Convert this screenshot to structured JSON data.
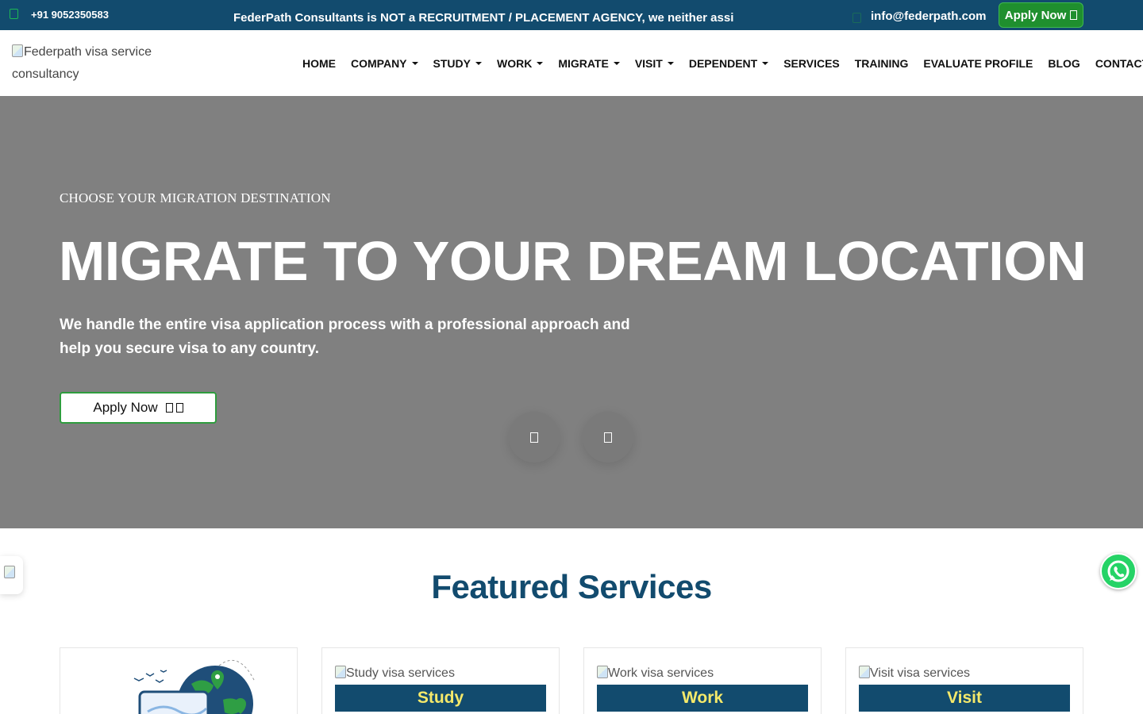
{
  "topbar": {
    "phone": "+91 9052350583",
    "notice": "FederPath Consultants is NOT a RECRUITMENT / PLACEMENT AGENCY, we neither assi",
    "email": "info@federpath.com",
    "apply_label": "Apply Now",
    "colors": {
      "background": "#124b6e",
      "apply": "#1f8f2e"
    }
  },
  "navbar": {
    "logo_alt": "Federpath visa service consultancy",
    "menu": [
      {
        "label": "HOME",
        "dropdown": false
      },
      {
        "label": "COMPANY",
        "dropdown": true
      },
      {
        "label": "STUDY",
        "dropdown": true
      },
      {
        "label": "WORK",
        "dropdown": true
      },
      {
        "label": "MIGRATE",
        "dropdown": true
      },
      {
        "label": "VISIT",
        "dropdown": true
      },
      {
        "label": "DEPENDENT",
        "dropdown": true
      },
      {
        "label": "SERVICES",
        "dropdown": false
      },
      {
        "label": "TRAINING",
        "dropdown": false
      },
      {
        "label": "EVALUATE PROFILE",
        "dropdown": false
      },
      {
        "label": "BLOG",
        "dropdown": false
      },
      {
        "label": "CONTACT US",
        "dropdown": false
      }
    ]
  },
  "hero": {
    "eyebrow": "CHOOSE YOUR MIGRATION DESTINATION",
    "title": "MIGRATE TO YOUR DREAM LOCATION",
    "subtitle": "We handle the entire visa application process with a professional approach and help you secure visa to any country.",
    "apply_label": "Apply Now"
  },
  "featured": {
    "title": "Featured Services",
    "cards": [
      {
        "alt": "",
        "label": ""
      },
      {
        "alt": "Study visa services",
        "label": "Study"
      },
      {
        "alt": "Work visa services",
        "label": "Work"
      },
      {
        "alt": "Visit visa services",
        "label": "Visit"
      }
    ],
    "colors": {
      "heading": "#124b6e",
      "label_text": "#f5e96a"
    }
  },
  "floating": {
    "whatsapp_icon": "whatsapp-icon"
  }
}
